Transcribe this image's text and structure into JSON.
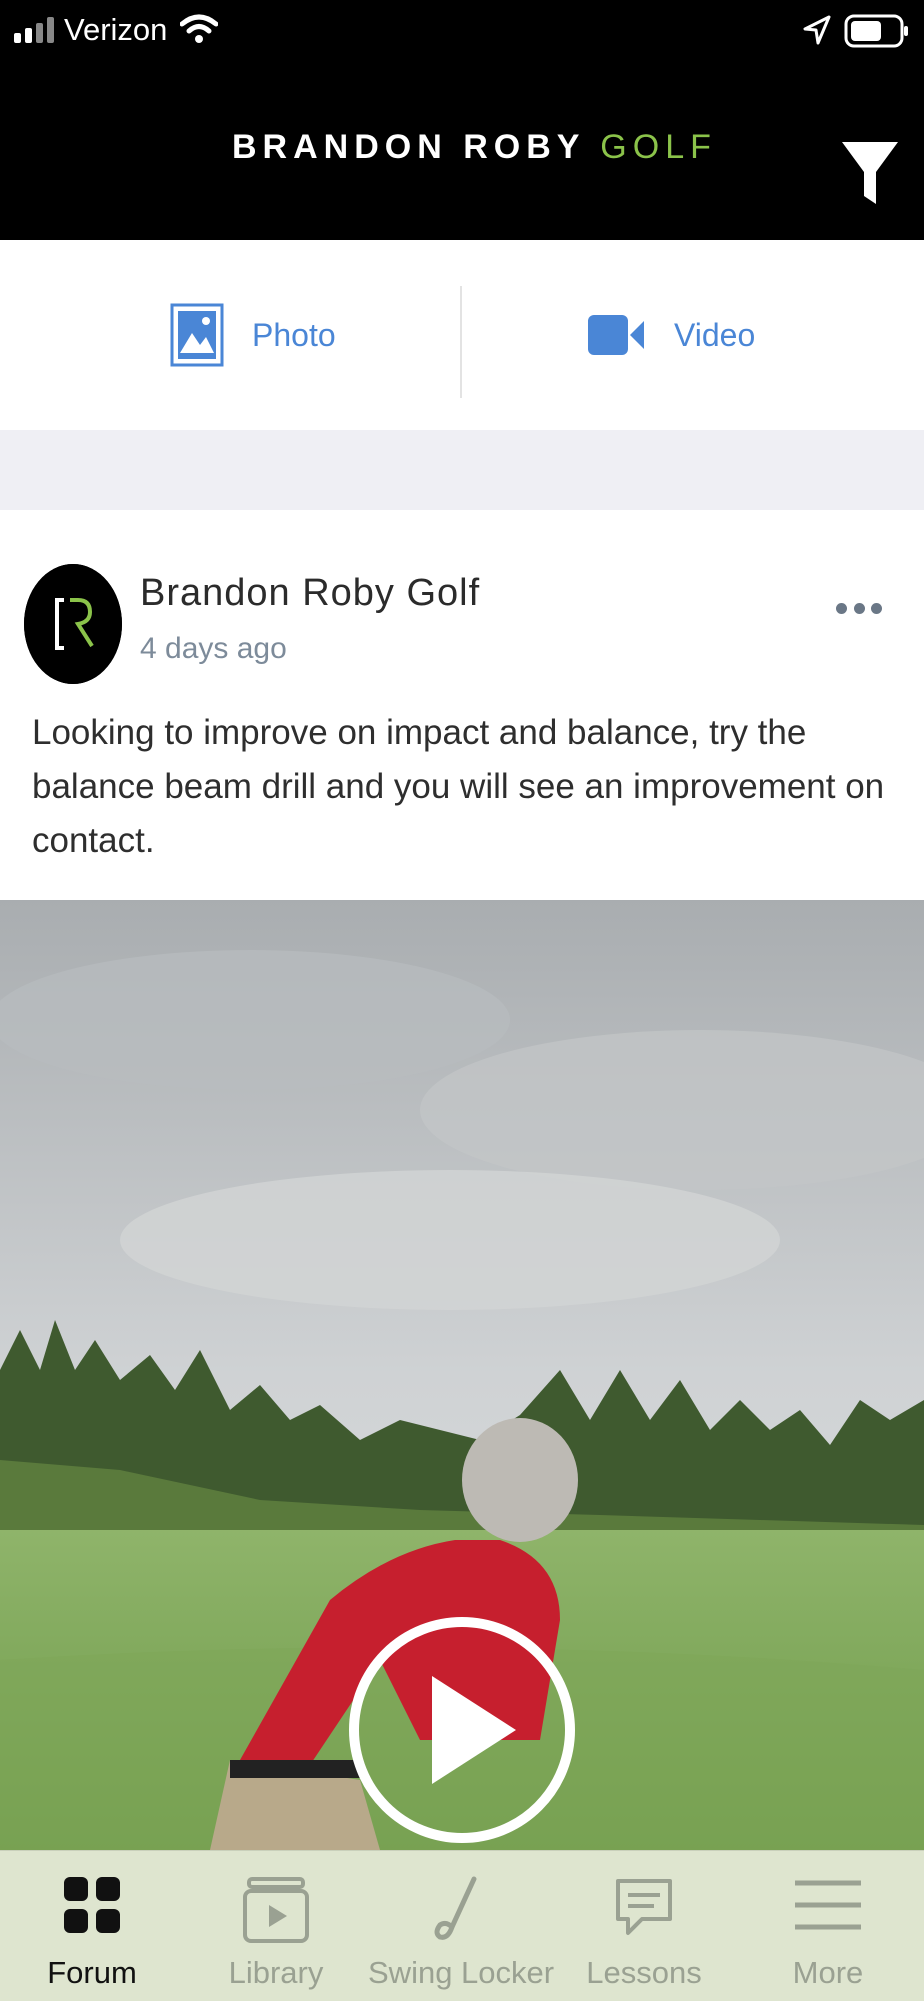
{
  "status_bar": {
    "carrier": "Verizon"
  },
  "header": {
    "brand_main": "BRANDON ROBY",
    "brand_accent": "GOLF",
    "accent_color": "#8bc34a"
  },
  "composer": {
    "photo_label": "Photo",
    "video_label": "Video",
    "action_color": "#4a86d6"
  },
  "post": {
    "author": "Brandon Roby Golf",
    "timestamp": "4 days ago",
    "text": "Looking to improve on impact and balance, try the balance beam drill and you will see an improvement on contact."
  },
  "tabs": [
    {
      "label": "Forum",
      "icon": "grid-icon",
      "active": true
    },
    {
      "label": "Library",
      "icon": "library-icon",
      "active": false
    },
    {
      "label": "Swing Locker",
      "icon": "golf-club-icon",
      "active": false
    },
    {
      "label": "Lessons",
      "icon": "chat-icon",
      "active": false
    },
    {
      "label": "More",
      "icon": "menu-icon",
      "active": false
    }
  ]
}
